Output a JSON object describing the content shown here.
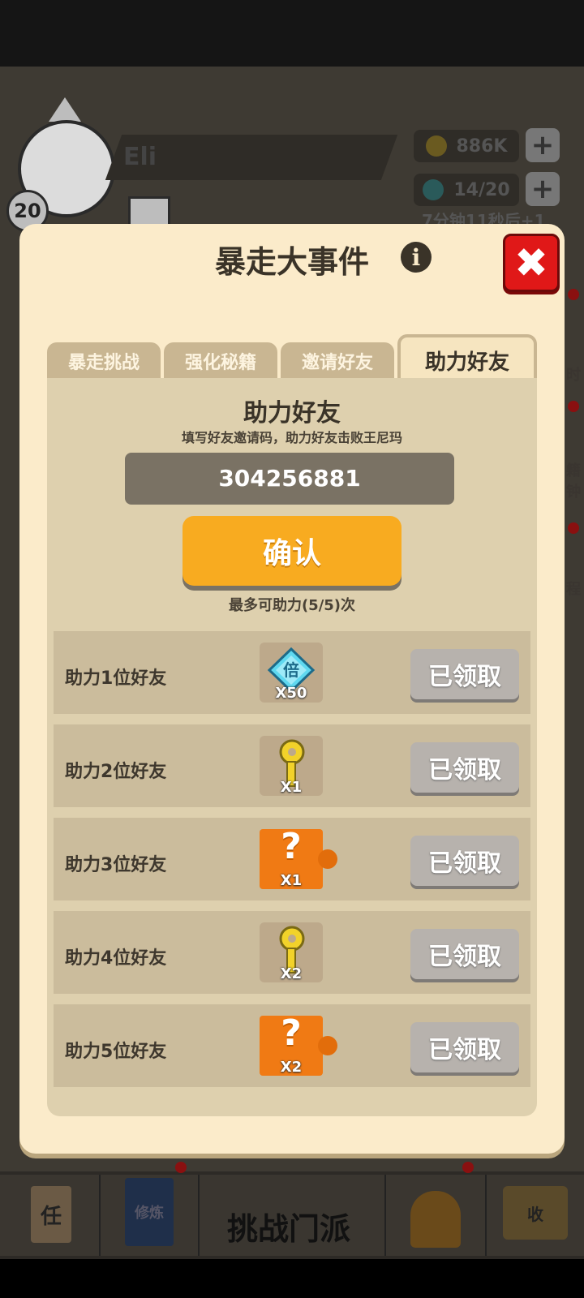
{
  "background": {
    "player_name": "Eli",
    "level": "20",
    "gold": "886K",
    "gems": "14/20",
    "timer_text": "7分钟11秒后+1",
    "nav_center_label": "挑战门派",
    "nav_left_icon_text": "任",
    "nav_book_text": "修炼",
    "nav_right_icon_text": "收",
    "side_labels": [
      "时",
      "籍",
      "钟",
      "程"
    ]
  },
  "dialog": {
    "title": "暴走大事件",
    "info_icon": "i",
    "close_icon": "✖",
    "tabs": [
      {
        "label": "暴走挑战",
        "active": false
      },
      {
        "label": "强化秘籍",
        "active": false
      },
      {
        "label": "邀请好友",
        "active": false
      },
      {
        "label": "助力好友",
        "active": true
      }
    ],
    "panel": {
      "title": "助力好友",
      "subtitle": "填写好友邀请码，助力好友击败王尼玛",
      "code_value": "304256881",
      "confirm_label": "确认",
      "limit_text": "最多可助力(5/5)次"
    },
    "rows": [
      {
        "label": "助力1位好友",
        "reward_icon": "diamond-multiplier-icon",
        "reward_symbol": "倍",
        "qty": "X50",
        "button": "已领取"
      },
      {
        "label": "助力2位好友",
        "reward_icon": "key-icon",
        "qty": "X1",
        "button": "已领取"
      },
      {
        "label": "助力3位好友",
        "reward_icon": "mystery-puzzle-icon",
        "reward_symbol": "?",
        "qty": "X1",
        "button": "已领取"
      },
      {
        "label": "助力4位好友",
        "reward_icon": "key-icon",
        "qty": "X2",
        "button": "已领取"
      },
      {
        "label": "助力5位好友",
        "reward_icon": "mystery-puzzle-icon",
        "reward_symbol": "?",
        "qty": "X2",
        "button": "已领取"
      }
    ]
  },
  "colors": {
    "dialog_bg": "#fbebca",
    "confirm": "#f8ab20",
    "close": "#e01818",
    "claimed": "#b7b2ad"
  }
}
